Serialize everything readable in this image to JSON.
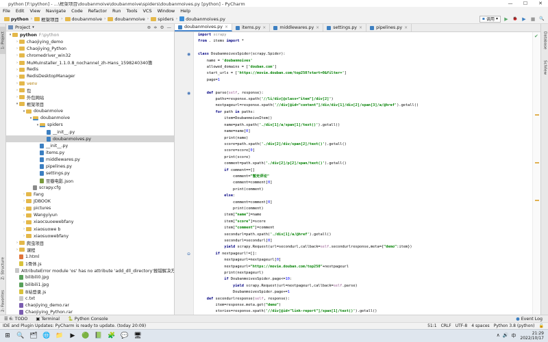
{
  "window": {
    "title": "python [F:\\python] - ...\\框架项目\\doubanmoive\\doubanmoive\\spiders\\doubanmoives.py [python] - PyCharm",
    "min": "—",
    "max": "☐",
    "close": "✕"
  },
  "menu": [
    "File",
    "Edit",
    "View",
    "Navigate",
    "Code",
    "Refactor",
    "Run",
    "Tools",
    "VCS",
    "Window",
    "Help"
  ],
  "breadcrumbs": [
    "python",
    "框架项目",
    "doubanmoive",
    "doubanmoive",
    "spiders",
    "doubanmoives.py"
  ],
  "run_config": {
    "label": "调用",
    "run": "▶",
    "debug": "🐞",
    "coverage": "▶",
    "stop": "■",
    "search": "🔍"
  },
  "project_panel": {
    "title": "Project",
    "tree": [
      {
        "indent": 0,
        "arrow": "▾",
        "icon": "folder",
        "label": "python",
        "note": "F:\\python",
        "bold": true
      },
      {
        "indent": 1,
        "arrow": "›",
        "icon": "folder",
        "label": "chaojiying_demo"
      },
      {
        "indent": 1,
        "arrow": "›",
        "icon": "folder",
        "label": "Chaojiying_Python"
      },
      {
        "indent": 1,
        "arrow": "›",
        "icon": "folder",
        "label": "chromedriver_win32"
      },
      {
        "indent": 1,
        "arrow": "›",
        "icon": "folder",
        "label": "MuMuInstaller_1.1.0.8_nochannel_zh-Hans_1598240340籌"
      },
      {
        "indent": 1,
        "arrow": "›",
        "icon": "folder",
        "label": "Redis"
      },
      {
        "indent": 1,
        "arrow": "›",
        "icon": "folder",
        "label": "RedisDesktopManager"
      },
      {
        "indent": 1,
        "arrow": "›",
        "icon": "folder",
        "label": "venv",
        "highlight": true
      },
      {
        "indent": 1,
        "arrow": "›",
        "icon": "folder",
        "label": "包"
      },
      {
        "indent": 1,
        "arrow": "›",
        "icon": "folder",
        "label": "外包网站"
      },
      {
        "indent": 1,
        "arrow": "▾",
        "icon": "folder",
        "label": "框架项目"
      },
      {
        "indent": 2,
        "arrow": "▾",
        "icon": "folder",
        "label": "doubanmoive"
      },
      {
        "indent": 3,
        "arrow": "▾",
        "icon": "pkg",
        "label": "doubanmoive"
      },
      {
        "indent": 4,
        "arrow": "▾",
        "icon": "pkg",
        "label": "spiders"
      },
      {
        "indent": 5,
        "arrow": "",
        "icon": "py",
        "label": "__init__.py"
      },
      {
        "indent": 5,
        "arrow": "",
        "icon": "py",
        "label": "doubanmoives.py",
        "selected": true
      },
      {
        "indent": 4,
        "arrow": "",
        "icon": "py",
        "label": "__init__.py"
      },
      {
        "indent": 4,
        "arrow": "",
        "icon": "py",
        "label": "items.py"
      },
      {
        "indent": 4,
        "arrow": "",
        "icon": "py",
        "label": "middlewares.py"
      },
      {
        "indent": 4,
        "arrow": "",
        "icon": "py",
        "label": "pipelines.py"
      },
      {
        "indent": 4,
        "arrow": "",
        "icon": "py",
        "label": "settings.py"
      },
      {
        "indent": 4,
        "arrow": "",
        "icon": "json",
        "label": "豆瓣电影.json"
      },
      {
        "indent": 3,
        "arrow": "",
        "icon": "cfg",
        "label": "scrapy.cfg"
      },
      {
        "indent": 2,
        "arrow": "›",
        "icon": "folder",
        "label": "Fang"
      },
      {
        "indent": 2,
        "arrow": "›",
        "icon": "folder",
        "label": "JDBOOK"
      },
      {
        "indent": 2,
        "arrow": "›",
        "icon": "folder",
        "label": "pictures"
      },
      {
        "indent": 2,
        "arrow": "›",
        "icon": "folder",
        "label": "Wangyiyun"
      },
      {
        "indent": 2,
        "arrow": "›",
        "icon": "folder",
        "label": "xiaocsuoewebfany"
      },
      {
        "indent": 2,
        "arrow": "›",
        "icon": "folder",
        "label": "xiaosuowe b"
      },
      {
        "indent": 2,
        "arrow": "›",
        "icon": "folder",
        "label": "xiaosuowebfany"
      },
      {
        "indent": 1,
        "arrow": "›",
        "icon": "folder",
        "label": "爬虫项目"
      },
      {
        "indent": 1,
        "arrow": "›",
        "icon": "folder",
        "label": "课程"
      },
      {
        "indent": 1,
        "arrow": "",
        "icon": "html",
        "label": "1.html"
      },
      {
        "indent": 1,
        "arrow": "",
        "icon": "js",
        "label": "1骨体.js"
      },
      {
        "indent": 1,
        "arrow": "",
        "icon": "txt",
        "label": "AttributeError module 'os' has no attribute 'add_dll_directory'报错解决方法.txt"
      },
      {
        "indent": 1,
        "arrow": "",
        "icon": "img",
        "label": "bilibili0.jpg"
      },
      {
        "indent": 1,
        "arrow": "",
        "icon": "img",
        "label": "bilibili1.jpg"
      },
      {
        "indent": 1,
        "arrow": "",
        "icon": "js",
        "label": "B站登录.js"
      },
      {
        "indent": 1,
        "arrow": "",
        "icon": "txt",
        "label": "c.txt"
      },
      {
        "indent": 1,
        "arrow": "",
        "icon": "rar",
        "label": "chaojiying_demo.rar"
      },
      {
        "indent": 1,
        "arrow": "",
        "icon": "rar",
        "label": "Chaojiying_Python.rar"
      }
    ]
  },
  "tabs": [
    {
      "label": "doubanmoives.py",
      "active": true
    },
    {
      "label": "items.py"
    },
    {
      "label": "middlewares.py"
    },
    {
      "label": "settings.py"
    },
    {
      "label": "pipelines.py"
    }
  ],
  "code_lines": [
    [
      [
        "kw",
        "import "
      ],
      [
        "cm",
        "scrapy"
      ]
    ],
    [
      [
        "kw",
        "from "
      ],
      [
        "",
        ". items "
      ],
      [
        "kw",
        "import "
      ],
      [
        "",
        "*"
      ]
    ],
    [
      [
        "",
        ""
      ]
    ],
    [
      [
        "kw",
        "class "
      ],
      [
        "",
        "DoubanmoivesSpider(scrapy.Spider):"
      ]
    ],
    [
      [
        "",
        "    name = "
      ],
      [
        "st",
        "'doubanmoives'"
      ]
    ],
    [
      [
        "",
        "    allowed_domains = ["
      ],
      [
        "st",
        "'douban.com'"
      ],
      [
        "",
        "]"
      ]
    ],
    [
      [
        "",
        "    start_urls = ["
      ],
      [
        "st",
        "'https://movie.douban.com/top250?start=0&filter='"
      ],
      [
        "",
        "]"
      ]
    ],
    [
      [
        "",
        "    page="
      ],
      [
        "num",
        "1"
      ]
    ],
    [
      [
        "",
        ""
      ]
    ],
    [
      [
        "",
        "    "
      ],
      [
        "kw",
        "def "
      ],
      [
        "",
        "parse("
      ],
      [
        "self",
        "self"
      ],
      [
        "",
        ", response):"
      ]
    ],
    [
      [
        "",
        "        paths=response.xpath("
      ],
      [
        "st",
        "'//li/div[@class=\"item\"]/div[2]'"
      ],
      [
        "",
        ")"
      ]
    ],
    [
      [
        "",
        "        nextpageurl=response.xpath("
      ],
      [
        "st",
        "'//div[@id=\"content\"]/div/div[1]/div[2]/span[3]/a/@href'"
      ],
      [
        "",
        ").getall()"
      ]
    ],
    [
      [
        "",
        "        "
      ],
      [
        "kw",
        "for "
      ],
      [
        "",
        "path "
      ],
      [
        "kw",
        "in "
      ],
      [
        "",
        "paths:"
      ]
    ],
    [
      [
        "",
        "            item=DoubanmoiveItem()"
      ]
    ],
    [
      [
        "",
        "            name=path.xpath("
      ],
      [
        "st",
        "'./div[1]/a/span[1]/text()'"
      ],
      [
        "",
        ").getall()"
      ]
    ],
    [
      [
        "",
        "            name=name["
      ],
      [
        "num",
        "0"
      ],
      [
        "",
        "]"
      ]
    ],
    [
      [
        "",
        "            print(name)"
      ]
    ],
    [
      [
        "",
        "            score=path.xpath("
      ],
      [
        "st",
        "'./div[2]/div/span[2]/text()'"
      ],
      [
        "",
        ").getall()"
      ]
    ],
    [
      [
        "",
        "            score=score["
      ],
      [
        "num",
        "0"
      ],
      [
        "",
        "]"
      ]
    ],
    [
      [
        "",
        "            print(score)"
      ]
    ],
    [
      [
        "",
        "            comment=path.xpath("
      ],
      [
        "st",
        "'./div[2]/p[2]/span/text()'"
      ],
      [
        "",
        ").getall()"
      ]
    ],
    [
      [
        "",
        "            "
      ],
      [
        "kw",
        "if "
      ],
      [
        "",
        "comment=="
      ],
      [
        "",
        "[]"
      ]
    ],
    [
      [
        "",
        "                comment="
      ],
      [
        "st",
        "\"暂无评论\""
      ]
    ],
    [
      [
        "",
        "                comment=comment["
      ],
      [
        "num",
        "0"
      ],
      [
        "",
        "]"
      ]
    ],
    [
      [
        "",
        "                print(comment)"
      ]
    ],
    [
      [
        "",
        "            "
      ],
      [
        "kw",
        "else"
      ],
      [
        "",
        ":"
      ]
    ],
    [
      [
        "",
        "                comment=comment["
      ],
      [
        "num",
        "0"
      ],
      [
        "",
        "]"
      ]
    ],
    [
      [
        "",
        "                print(comment)"
      ]
    ],
    [
      [
        "",
        "            item["
      ],
      [
        "st",
        "\"name\""
      ],
      [
        "",
        "]=name"
      ]
    ],
    [
      [
        "",
        "            item["
      ],
      [
        "st",
        "\"score\""
      ],
      [
        "",
        "]=score"
      ]
    ],
    [
      [
        "",
        "            item["
      ],
      [
        "st",
        "\"comment\""
      ],
      [
        "",
        "]=comment"
      ]
    ],
    [
      [
        "",
        "            secondurl=path.xpath("
      ],
      [
        "st",
        "'./div[1]/a/@href'"
      ],
      [
        "",
        ").getall()"
      ]
    ],
    [
      [
        "",
        "            secondurl=secondurl["
      ],
      [
        "num",
        "0"
      ],
      [
        "",
        "]"
      ]
    ],
    [
      [
        "",
        "            "
      ],
      [
        "kw",
        "yield "
      ],
      [
        "",
        "scrapy.Request(url=secondurl,callback="
      ],
      [
        "self",
        "self"
      ],
      [
        "",
        ".secondurlresponse,meta={"
      ],
      [
        "st",
        "\"demo\""
      ],
      [
        "",
        ":item})"
      ]
    ],
    [
      [
        "",
        "        "
      ],
      [
        "kw",
        "if "
      ],
      [
        "",
        "nextpageurl!=[]:"
      ]
    ],
    [
      [
        "",
        "            nextpageurl=nextpageurl["
      ],
      [
        "num",
        "0"
      ],
      [
        "",
        "]"
      ]
    ],
    [
      [
        "",
        "            nextpageurl="
      ],
      [
        "st",
        "\"https://movie.douban.com/top250\""
      ],
      [
        "",
        "+nextpageurl"
      ]
    ],
    [
      [
        "",
        "            print(nextpageurl)"
      ]
    ],
    [
      [
        "",
        "            "
      ],
      [
        "kw",
        "if "
      ],
      [
        "",
        "DoubanmoivesSpider.page<="
      ],
      [
        "num",
        "10"
      ],
      [
        "",
        ":"
      ]
    ],
    [
      [
        "",
        "                "
      ],
      [
        "kw",
        "yield "
      ],
      [
        "",
        "scrapy.Request(url=nextpageurl,callback="
      ],
      [
        "self",
        "self"
      ],
      [
        "",
        ".parse)"
      ]
    ],
    [
      [
        "",
        "                DoubanmoivesSpider.page+="
      ],
      [
        "num",
        "1"
      ]
    ],
    [
      [
        "",
        "    "
      ],
      [
        "kw",
        "def "
      ],
      [
        "",
        "secondurlresponse("
      ],
      [
        "self",
        "self"
      ],
      [
        "",
        ", response):"
      ]
    ],
    [
      [
        "",
        "        item=response.meta.get("
      ],
      [
        "st",
        "\"demo\""
      ],
      [
        "",
        ")"
      ]
    ],
    [
      [
        "",
        "        stories=response.xpath("
      ],
      [
        "st",
        "'//div[@id=\"link-report\"]/span[1]/text()'"
      ],
      [
        "",
        ").getall()"
      ]
    ]
  ],
  "gutter_marks": [
    {
      "line": 3,
      "glyph": "◉"
    },
    {
      "line": 9,
      "glyph": "◉"
    },
    {
      "line": 34,
      "glyph": "⊖"
    }
  ],
  "left_strip": {
    "project": "1: Project",
    "structure": "Z: Structure",
    "favorites": "2: Favorites"
  },
  "right_strip": {
    "database": "Database",
    "sciview": "SciView"
  },
  "bottom_tools": [
    {
      "icon": "☰",
      "label": "6: TODO"
    },
    {
      "icon": "▣",
      "label": "Terminal"
    },
    {
      "icon": "🐍",
      "label": "Python Console"
    }
  ],
  "event_log": "Event Log",
  "status": {
    "message": "IDE and Plugin Updates: PyCharm is ready to update. (today 20:09)",
    "position": "51:1",
    "line_sep": "CRLF",
    "encoding": "UTF-8",
    "indent": "4 spaces",
    "interpreter": "Python 3.8 (python)"
  },
  "taskbar": {
    "time": "21:29",
    "date": "2022/10/17",
    "apps": [
      "⊞",
      "🔍",
      "🗂",
      "🌐",
      "📁",
      "▶",
      "🟢",
      "📗",
      "🧩",
      "💬",
      "🖥"
    ],
    "tray": [
      "∧",
      "🔊",
      "中"
    ]
  }
}
